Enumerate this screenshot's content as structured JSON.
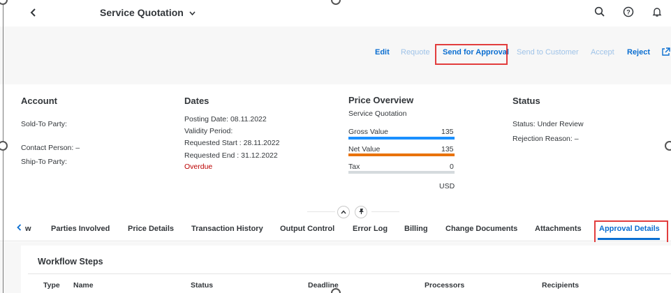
{
  "shell": {
    "title": "Service Quotation",
    "back_icon": "chevron-left-icon",
    "icons": [
      "search-icon",
      "help-icon",
      "notification-bell-icon"
    ]
  },
  "actions": {
    "edit": "Edit",
    "requote": "Requote",
    "send_for_approval": "Send for Approval",
    "send_to_customer": "Send to Customer",
    "accept": "Accept",
    "reject": "Reject",
    "share_icon": "share-icon"
  },
  "account": {
    "title": "Account",
    "sold_to_label": "Sold-To Party:",
    "contact_label": "Contact Person:",
    "contact_value": "–",
    "ship_to_label": "Ship-To Party:"
  },
  "dates": {
    "title": "Dates",
    "posting_label": "Posting Date:",
    "posting_value": "08.11.2022",
    "validity_label": "Validity Period:",
    "req_start_label": "Requested Start :",
    "req_start_value": "28.11.2022",
    "req_end_label": "Requested End :",
    "req_end_value": "31.12.2022",
    "overdue": "Overdue"
  },
  "price": {
    "title": "Price Overview",
    "subtitle": "Service Quotation",
    "gross_label": "Gross Value",
    "gross_value": "135",
    "net_label": "Net Value",
    "net_value": "135",
    "tax_label": "Tax",
    "tax_value": "0",
    "currency": "USD",
    "colors": {
      "gross": "#1b90ff",
      "net": "#e9730c",
      "tax": "#d5dadd"
    }
  },
  "status": {
    "title": "Status",
    "status_label": "Status:",
    "status_value": "Under Review",
    "rejection_label": "Rejection Reason:",
    "rejection_value": "–"
  },
  "tabs": {
    "scroll_left_icon": "chevron-left-icon",
    "items": [
      "w",
      "Parties Involved",
      "Price Details",
      "Transaction History",
      "Output Control",
      "Error Log",
      "Billing",
      "Change Documents",
      "Attachments",
      "Approval Details"
    ],
    "active": "Approval Details"
  },
  "workflow": {
    "title": "Workflow Steps",
    "columns": [
      "Type",
      "Name",
      "Status",
      "Deadline",
      "Processors",
      "Recipients"
    ]
  },
  "colors": {
    "accent": "#0a6ed1",
    "highlight": "#e23d3d",
    "overdue": "#bb0000"
  }
}
